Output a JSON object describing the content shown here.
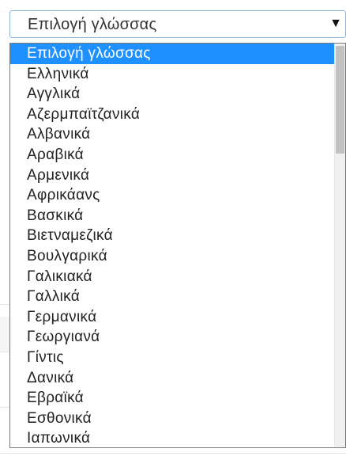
{
  "language_select": {
    "selected_value": "Επιλογή γλώσσας",
    "arrow_icon": "triangle-down-icon",
    "border_color": "#8fb2d9",
    "highlight_color": "#1e90ff",
    "options": [
      "Επιλογή γλώσσας",
      "Ελληνικά",
      "Αγγλικά",
      "Αζερμπαϊτζανικά",
      "Αλβανικά",
      "Αραβικά",
      "Αρμενικά",
      "Αφρικάανς",
      "Βασκικά",
      "Βιετναμεζικά",
      "Βουλγαρικά",
      "Γαλικιακά",
      "Γαλλικά",
      "Γερμανικά",
      "Γεωργιανά",
      "Γίντις",
      "Δανικά",
      "Εβραϊκά",
      "Εσθονικά",
      "Ιαπωνικά"
    ]
  }
}
